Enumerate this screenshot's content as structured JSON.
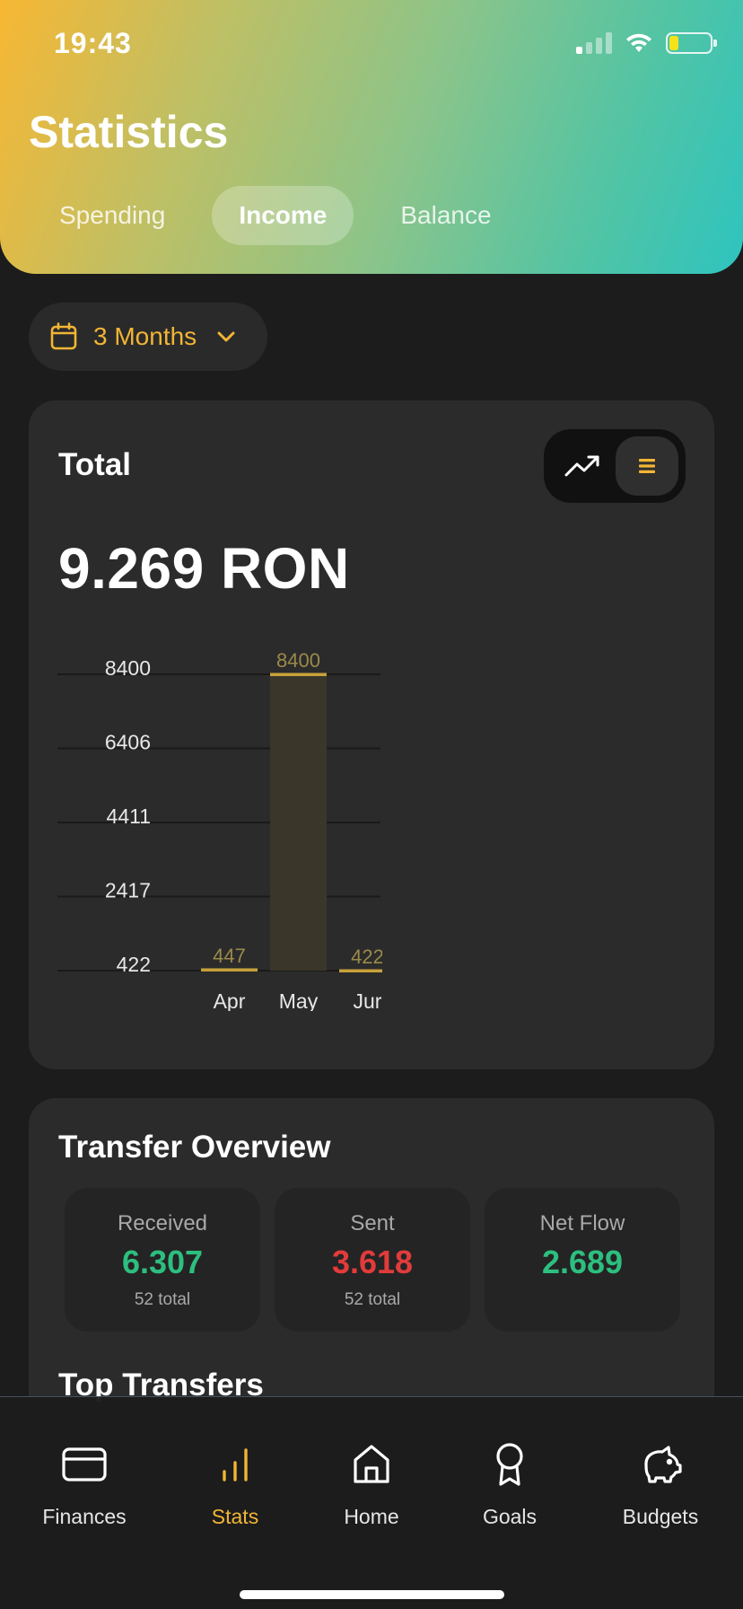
{
  "status_bar": {
    "time": "19:43"
  },
  "header": {
    "title": "Statistics",
    "tabs": [
      {
        "label": "Spending",
        "active": false
      },
      {
        "label": "Income",
        "active": true
      },
      {
        "label": "Balance",
        "active": false
      }
    ]
  },
  "period": {
    "label": "3 Months",
    "icon": "calendar-icon"
  },
  "total_card": {
    "title": "Total",
    "amount": "9.269 RON",
    "view_toggle": {
      "options": [
        "trend-line-icon",
        "bar-list-icon"
      ],
      "active": "bar-list-icon"
    }
  },
  "chart_data": {
    "type": "bar",
    "categories": [
      "Apr",
      "May",
      "Jun"
    ],
    "category_labels": [
      "Apr",
      "May",
      "Jur"
    ],
    "values": [
      447,
      8400,
      422
    ],
    "value_labels": [
      "447",
      "8400",
      "422"
    ],
    "yticks": [
      8400,
      6406,
      4411,
      2417,
      422
    ],
    "ylim": [
      422,
      8400
    ],
    "grid": true,
    "bar_color": "#3b362a",
    "bar_accent": "#c8a23a",
    "label_color": "#9b8a4a"
  },
  "transfer_overview": {
    "title": "Transfer Overview",
    "received": {
      "label": "Received",
      "value": "6.307",
      "sub": "52 total"
    },
    "sent": {
      "label": "Sent",
      "value": "3.618",
      "sub": "52 total"
    },
    "net_flow": {
      "label": "Net Flow",
      "value": "2.689"
    }
  },
  "top_transfers": {
    "title": "Top Transfers"
  },
  "bottom_nav": {
    "items": [
      {
        "label": "Finances",
        "icon": "credit-card-icon"
      },
      {
        "label": "Stats",
        "icon": "bar-chart-icon",
        "active": true
      },
      {
        "label": "Home",
        "icon": "home-icon"
      },
      {
        "label": "Goals",
        "icon": "award-icon"
      },
      {
        "label": "Budgets",
        "icon": "piggy-bank-icon"
      }
    ]
  },
  "colors": {
    "accent": "#f2b534",
    "positive": "#2dbf7f",
    "negative": "#e23b3b"
  }
}
